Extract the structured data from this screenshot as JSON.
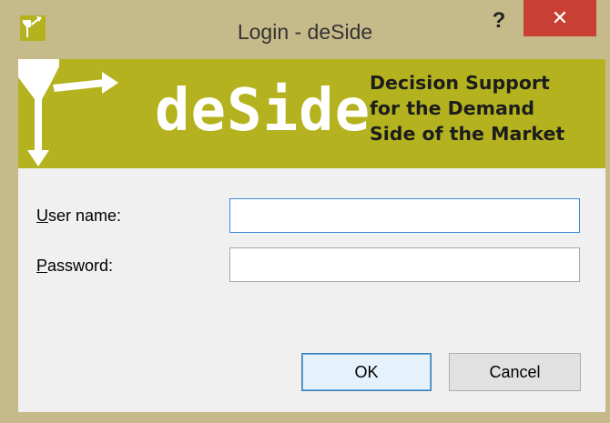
{
  "window": {
    "title": "Login - deSide",
    "help_label": "?",
    "close_label": "✕",
    "colors": {
      "frame": "#c7ba8a",
      "close": "#c84033",
      "banner": "#b4b31f"
    }
  },
  "banner": {
    "logo_text": "deSide",
    "tagline": [
      "Decision Support",
      "for the Demand",
      "Side of the Market"
    ]
  },
  "form": {
    "username": {
      "label_first": "U",
      "label_rest": "ser name:",
      "value": ""
    },
    "password": {
      "label_first": "P",
      "label_rest": "assword:",
      "value": ""
    }
  },
  "buttons": {
    "ok": "OK",
    "cancel": "Cancel"
  },
  "icons": [
    "app-logo-icon",
    "help-icon",
    "close-icon",
    "funnel-logo-icon"
  ]
}
